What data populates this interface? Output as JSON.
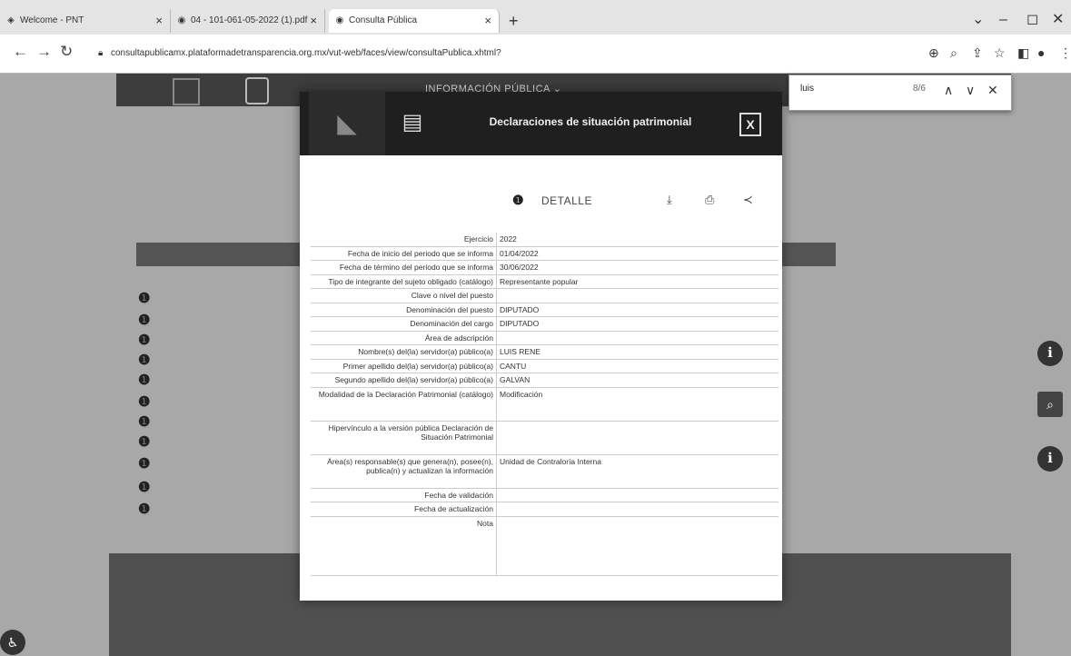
{
  "browser": {
    "tabs": [
      {
        "label": "Welcome - PNT",
        "active": false
      },
      {
        "label": "04 - 101-061-05-2022 (1).pdf",
        "active": false
      },
      {
        "label": "Consulta Pública",
        "active": true
      }
    ],
    "url": "consultapublicamx.plataformadetransparencia.org.mx/vut-web/faces/view/consultaPublica.xhtml?",
    "find": {
      "query": "luis",
      "count": "8/6"
    }
  },
  "page": {
    "top_menu": "INFORMACIÓN PÚBLICA ⌄"
  },
  "modal": {
    "title": "Declaraciones de situación patrimonial",
    "close_label": "X",
    "detail_label": "DETALLE",
    "rows": [
      {
        "label": "Ejercicio",
        "value": "2022"
      },
      {
        "label": "Fecha de inicio del periodo que se informa",
        "value": "01/04/2022"
      },
      {
        "label": "Fecha de término del periodo que se informa",
        "value": "30/06/2022"
      },
      {
        "label": "Tipo de integrante del sujeto obligado (catálogo)",
        "value": "Representante popular"
      },
      {
        "label": "Clave o nivel del puesto",
        "value": ""
      },
      {
        "label": "Denominación del puesto",
        "value": "DIPUTADO"
      },
      {
        "label": "Denominación del cargo",
        "value": "DIPUTADO"
      },
      {
        "label": "Área de adscripción",
        "value": ""
      },
      {
        "label": "Nombre(s) del(la) servidor(a) público(a)",
        "value": "LUIS RENE"
      },
      {
        "label": "Primer apellido del(la) servidor(a) público(a)",
        "value": "CANTU"
      },
      {
        "label": "Segundo apellido del(la) servidor(a) público(a)",
        "value": "GALVAN"
      },
      {
        "label": "Modalidad de la Declaración Patrimonial (catálogo)",
        "value": "Modificación"
      },
      {
        "label": "Hipervínculo a la versión pública Declaración de Situación Patrimonial",
        "value": ""
      },
      {
        "label": "Área(s) responsable(s) que genera(n), posee(n), publica(n) y actualizan la información",
        "value": "Unidad de Contraloría Interna"
      },
      {
        "label": "Fecha de validación",
        "value": ""
      },
      {
        "label": "Fecha de actualización",
        "value": ""
      },
      {
        "label": "Nota",
        "value": ""
      }
    ]
  }
}
